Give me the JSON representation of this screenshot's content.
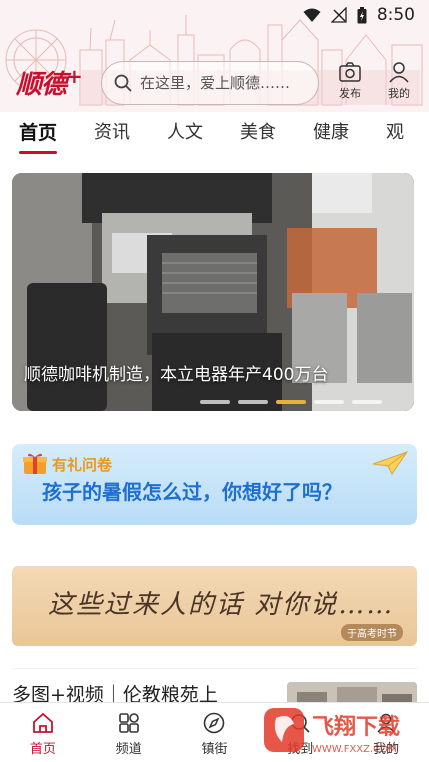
{
  "status_bar": {
    "time": "8:50"
  },
  "header": {
    "logo_text": "顺德",
    "logo_plus": "+",
    "search_placeholder": "在这里，爱上顺德……",
    "publish_label": "发布",
    "mine_label": "我的"
  },
  "tabs": [
    {
      "label": "首页",
      "active": true
    },
    {
      "label": "资讯",
      "active": false
    },
    {
      "label": "人文",
      "active": false
    },
    {
      "label": "美食",
      "active": false
    },
    {
      "label": "健康",
      "active": false
    },
    {
      "label": "观",
      "active": false
    }
  ],
  "hero": {
    "caption": "顺德咖啡机制造，本立电器年产400万台",
    "slide_count": 5,
    "active_slide": 3
  },
  "survey": {
    "tag": "有礼问卷",
    "title": "孩子的暑假怎么过，你想好了吗？"
  },
  "exam": {
    "title": "这些过来人的话 对你说……",
    "subtitle": "于高考时节"
  },
  "news": [
    {
      "title": "多图+视频｜伦教粮苑上"
    }
  ],
  "bottom_nav": [
    {
      "label": "首页",
      "icon": "home-icon",
      "active": true
    },
    {
      "label": "频道",
      "icon": "grid-icon",
      "active": false
    },
    {
      "label": "镇街",
      "icon": "compass-icon",
      "active": false
    },
    {
      "label": "找到",
      "icon": "search-icon",
      "active": false
    },
    {
      "label": "我的",
      "icon": "user-icon",
      "active": false
    }
  ],
  "watermark": {
    "text": "飞翔下载",
    "url": "WWW.FXXZ.COM"
  },
  "colors": {
    "brand_red": "#c8102e",
    "survey_blue": "#1e6fd0",
    "dot_active": "#e6b13a"
  }
}
